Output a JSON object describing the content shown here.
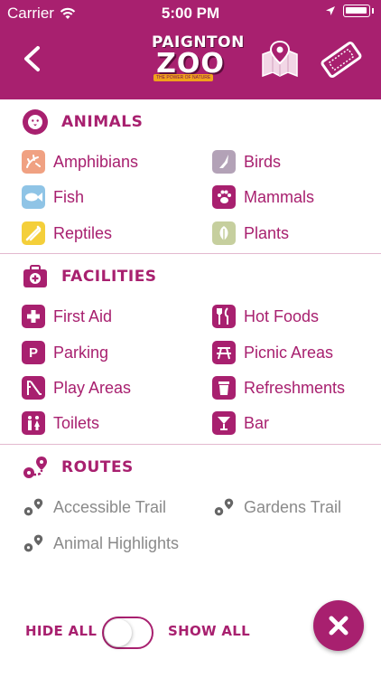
{
  "status_bar": {
    "carrier": "Carrier",
    "time": "5:00 PM"
  },
  "header": {
    "logo_line1": "PAIGNTON",
    "logo_line2": "ZOO",
    "logo_tagline": "THE POWER OF NATURE",
    "back_icon": "chevron-left-icon",
    "map_icon": "map-pin-icon",
    "ticket_icon": "ticket-icon",
    "accent": "#a8206f"
  },
  "sections": {
    "animals": {
      "title": "ANIMALS",
      "icon": "lion-icon",
      "items": [
        {
          "label": "Amphibians",
          "icon": "frog-icon",
          "color": "#f0a182"
        },
        {
          "label": "Birds",
          "icon": "bird-icon",
          "color": "#b3a2b7"
        },
        {
          "label": "Fish",
          "icon": "fish-icon",
          "color": "#8fc4e6"
        },
        {
          "label": "Mammals",
          "icon": "paw-icon",
          "color": "#a8206f"
        },
        {
          "label": "Reptiles",
          "icon": "snake-icon",
          "color": "#f4cf3a"
        },
        {
          "label": "Plants",
          "icon": "leaf-icon",
          "color": "#c6cf9e"
        }
      ]
    },
    "facilities": {
      "title": "FACILITIES",
      "icon": "first-aid-kit-icon",
      "items": [
        {
          "label": "First Aid",
          "icon": "cross-icon"
        },
        {
          "label": "Hot Foods",
          "icon": "utensils-icon"
        },
        {
          "label": "Parking",
          "icon": "parking-icon",
          "glyph": "P"
        },
        {
          "label": "Picnic Areas",
          "icon": "picnic-table-icon"
        },
        {
          "label": "Play Areas",
          "icon": "slide-icon"
        },
        {
          "label": "Refreshments",
          "icon": "cup-icon"
        },
        {
          "label": "Toilets",
          "icon": "toilets-icon"
        },
        {
          "label": "Bar",
          "icon": "cocktail-icon"
        }
      ]
    },
    "routes": {
      "title": "ROUTES",
      "icon": "route-icon",
      "items": [
        {
          "label": "Accessible Trail",
          "icon": "route-icon"
        },
        {
          "label": "Gardens Trail",
          "icon": "route-icon"
        },
        {
          "label": "Animal Highlights",
          "icon": "route-icon"
        }
      ]
    }
  },
  "footer": {
    "hide_all": "HIDE ALL",
    "show_all": "SHOW ALL",
    "close_icon": "close-icon"
  }
}
